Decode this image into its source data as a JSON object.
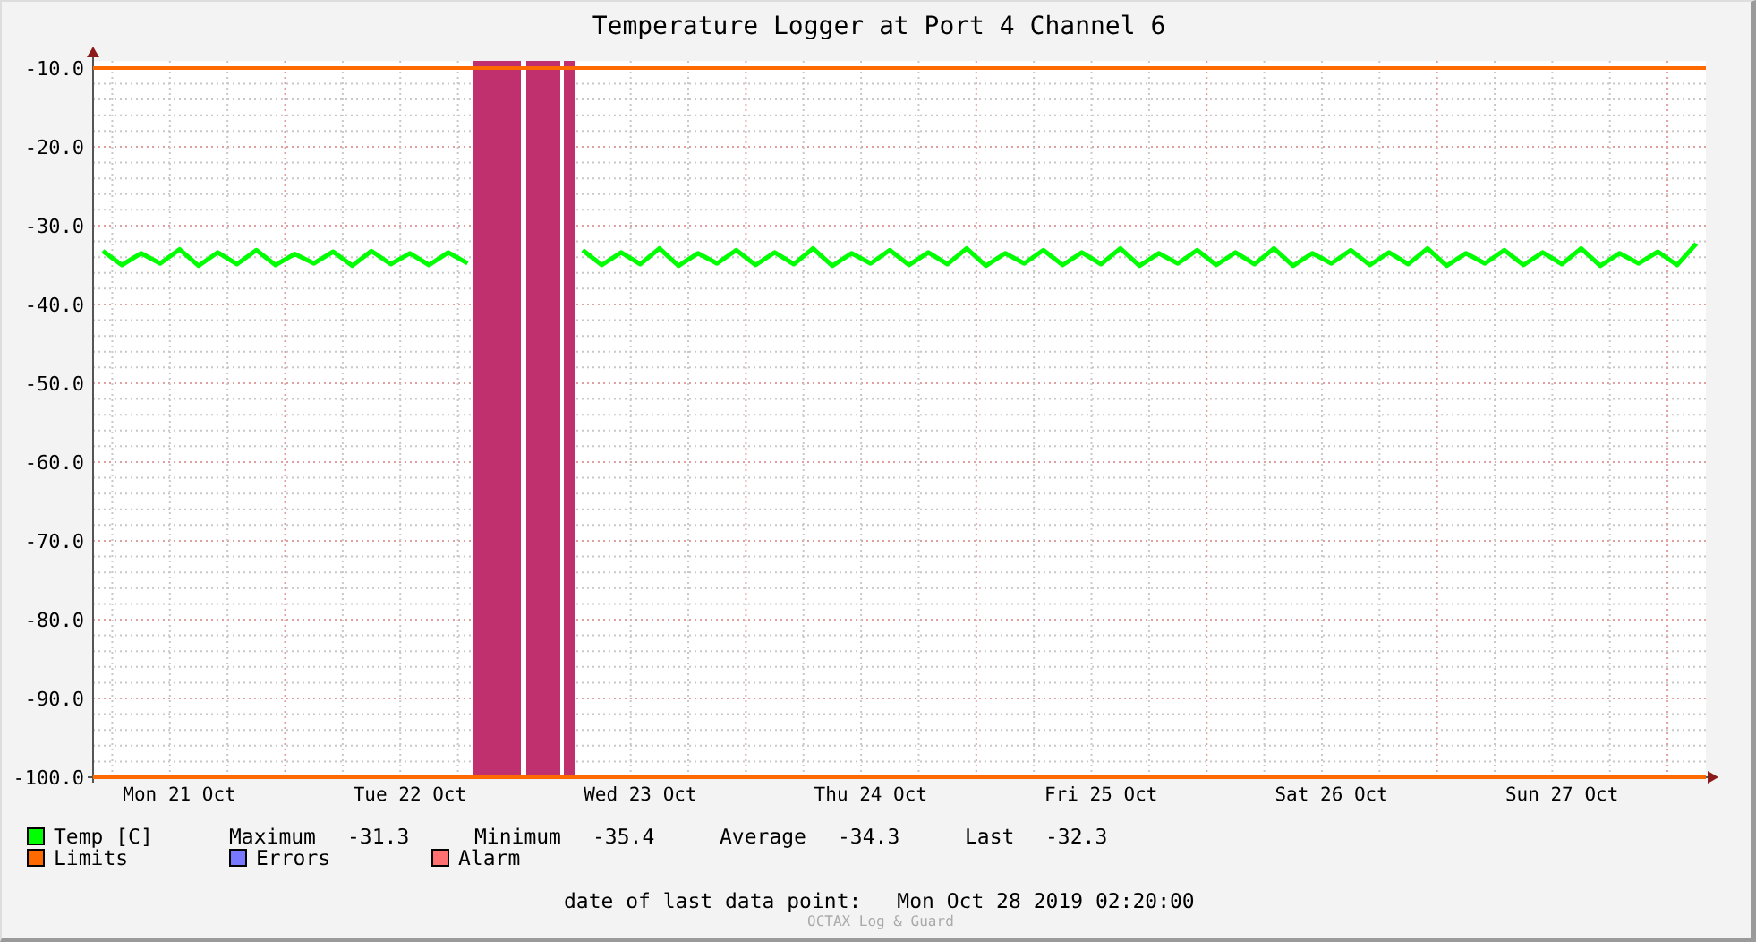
{
  "chart_data": {
    "type": "line",
    "title": "Temperature Logger at Port 4 Channel 6",
    "ylim": [
      -100,
      -9.1
    ],
    "grid": true,
    "yticks": [
      {
        "value": -10,
        "label": "-10.0"
      },
      {
        "value": -20,
        "label": "-20.0"
      },
      {
        "value": -30,
        "label": "-30.0"
      },
      {
        "value": -40,
        "label": "-40.0"
      },
      {
        "value": -50,
        "label": "-50.0"
      },
      {
        "value": -60,
        "label": "-60.0"
      },
      {
        "value": -70,
        "label": "-70.0"
      },
      {
        "value": -80,
        "label": "-80.0"
      },
      {
        "value": -90,
        "label": "-90.0"
      },
      {
        "value": -100,
        "label": "-100.0"
      }
    ],
    "categories": [
      null,
      null,
      null,
      null,
      "Mon 21 Oct",
      null,
      null,
      null,
      null,
      null,
      null,
      null,
      null,
      null,
      null,
      null,
      "Tue 22 Oct",
      null,
      null,
      null,
      null,
      null,
      null,
      null,
      null,
      null,
      null,
      null,
      "Wed 23 Oct",
      null,
      null,
      null,
      null,
      null,
      null,
      null,
      null,
      null,
      null,
      null,
      "Thu 24 Oct",
      null,
      null,
      null,
      null,
      null,
      null,
      null,
      null,
      null,
      null,
      null,
      "Fri 25 Oct",
      null,
      null,
      null,
      null,
      null,
      null,
      null,
      null,
      null,
      null,
      null,
      "Sat 26 Oct",
      null,
      null,
      null,
      null,
      null,
      null,
      null,
      null,
      null,
      null,
      null,
      "Sun 27 Oct",
      null,
      null,
      null,
      null,
      null,
      null,
      null
    ],
    "series": [
      {
        "name": "Temp [C]",
        "color": "#00ff00",
        "values": [
          -33.2,
          -35.0,
          -33.5,
          -34.8,
          -33.0,
          -35.1,
          -33.4,
          -34.9,
          -33.1,
          -35.0,
          -33.6,
          -34.8,
          -33.3,
          -35.1,
          -33.2,
          -34.9,
          -33.5,
          -35.0,
          -33.4,
          -34.8,
          null,
          null,
          null,
          null,
          null,
          -33.1,
          -35.0,
          -33.4,
          -34.9,
          -32.9,
          -35.1,
          -33.5,
          -34.8,
          -33.1,
          -35.0,
          -33.4,
          -34.9,
          -32.9,
          -35.1,
          -33.5,
          -34.8,
          -33.1,
          -35.0,
          -33.4,
          -34.9,
          -32.9,
          -35.1,
          -33.5,
          -34.8,
          -33.1,
          -35.0,
          -33.4,
          -34.9,
          -32.9,
          -35.1,
          -33.5,
          -34.8,
          -33.1,
          -35.0,
          -33.4,
          -34.9,
          -32.9,
          -35.1,
          -33.5,
          -34.8,
          -33.1,
          -35.0,
          -33.4,
          -34.9,
          -32.9,
          -35.1,
          -33.5,
          -34.8,
          -33.1,
          -35.0,
          -33.4,
          -34.9,
          -32.9,
          -35.1,
          -33.5,
          -34.8,
          -33.3,
          -35.0,
          -32.3
        ]
      }
    ],
    "ref_lines": [
      {
        "axis": "y",
        "value": -10,
        "color": "#ff6a00"
      },
      {
        "axis": "y",
        "value": -100,
        "color": "#ff6a00"
      }
    ]
  },
  "legend": [
    {
      "label": "Limits",
      "color": "#ff6a00"
    },
    {
      "label": "Errors",
      "color": "#7777ff"
    },
    {
      "label": "Alarm",
      "color": "#ff7070"
    }
  ],
  "stats": [
    {
      "label": "Maximum",
      "value": "-31.3"
    },
    {
      "label": "Minimum",
      "value": "-35.4"
    },
    {
      "label": "Average",
      "value": "-34.3"
    },
    {
      "label": "Last",
      "value": "-32.3"
    }
  ],
  "footer": {
    "label": "date of last data point:",
    "value": "Mon Oct 28 2019 02:20:00"
  },
  "watermark": "OCTAX Log & Guard"
}
